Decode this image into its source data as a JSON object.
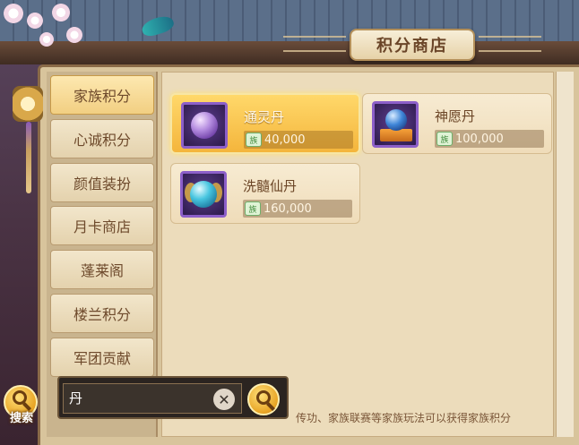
{
  "header": {
    "title": "积分商店"
  },
  "sidebar": {
    "tabs": [
      {
        "label": "家族积分",
        "active": true
      },
      {
        "label": "心诚积分",
        "active": false
      },
      {
        "label": "颜值装扮",
        "active": false
      },
      {
        "label": "月卡商店",
        "active": false
      },
      {
        "label": "蓬莱阁",
        "active": false
      },
      {
        "label": "楼兰积分",
        "active": false
      },
      {
        "label": "军团贡献",
        "active": false
      }
    ]
  },
  "shop": {
    "items": [
      {
        "name": "通灵丹",
        "price": "40,000",
        "icon": "purple-pill-icon",
        "selected": true
      },
      {
        "name": "神愿丹",
        "price": "100,000",
        "icon": "blue-pill-on-pedestal-icon",
        "selected": false
      },
      {
        "name": "洗髓仙丹",
        "price": "160,000",
        "icon": "teal-winged-pill-icon",
        "selected": false
      }
    ],
    "currency_icon": "family-point-coin-icon",
    "currency_glyph": "族"
  },
  "search": {
    "value": "丹",
    "clear_icon": "clear-icon",
    "toggle_label": "搜索"
  },
  "footer": {
    "hint": "传功、家族联赛等家族玩法可以获得家族积分"
  },
  "colors": {
    "selected_card": "#f4b53c",
    "tab_active": "#f2cf82",
    "title_text": "#6a4528"
  }
}
